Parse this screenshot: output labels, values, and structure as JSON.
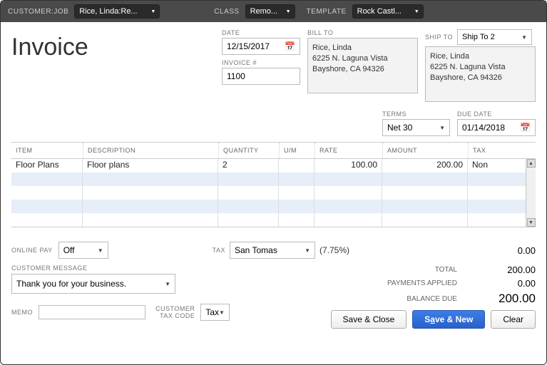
{
  "topbar": {
    "customerJobLabel": "CUSTOMER:JOB",
    "customerJob": "Rice, Linda:Re...",
    "classLabel": "CLASS",
    "class": "Remo...",
    "templateLabel": "TEMPLATE",
    "template": "Rock Castl..."
  },
  "title": "Invoice",
  "dateLabel": "DATE",
  "date": "12/15/2017",
  "invoiceNumLabel": "INVOICE #",
  "invoiceNum": "1100",
  "billToLabel": "BILL TO",
  "billTo": {
    "name": "Rice, Linda",
    "street": "6225 N. Laguna Vista",
    "cityzip": "Bayshore, CA 94326"
  },
  "shipToLabel": "SHIP TO",
  "shipToSel": "Ship To 2",
  "shipTo": {
    "name": "Rice, Linda",
    "street": "6225 N. Laguna Vista",
    "cityzip": "Bayshore, CA 94326"
  },
  "termsLabel": "TERMS",
  "terms": "Net 30",
  "dueDateLabel": "DUE DATE",
  "dueDate": "01/14/2018",
  "cols": {
    "item": "ITEM",
    "desc": "DESCRIPTION",
    "qty": "QUANTITY",
    "um": "U/M",
    "rate": "RATE",
    "amt": "AMOUNT",
    "tax": "TAX"
  },
  "line": {
    "item": "Floor Plans",
    "desc": "Floor plans",
    "qty": "2",
    "um": "",
    "rate": "100.00",
    "amt": "200.00",
    "tax": "Non"
  },
  "onlinePayLabel": "ONLINE PAY",
  "onlinePay": "Off",
  "custMsgLabel": "CUSTOMER MESSAGE",
  "custMsg": "Thank you for your business.",
  "memoLabel": "MEMO",
  "memo": "",
  "custTaxCodeLabel1": "CUSTOMER",
  "custTaxCodeLabel2": "TAX CODE",
  "custTaxCode": "Tax",
  "taxLabel": "TAX",
  "taxItem": "San Tomas",
  "taxRate": "(7.75%)",
  "taxAmt": "0.00",
  "totalLabel": "TOTAL",
  "total": "200.00",
  "paymentsLabel": "PAYMENTS APPLIED",
  "payments": "0.00",
  "balanceLabel": "BALANCE DUE",
  "balance": "200.00",
  "buttons": {
    "saveClose": "Save & Close",
    "saveNewPre": "S",
    "saveNewU": "a",
    "saveNewPost": "ve & New",
    "clear": "Clear"
  }
}
